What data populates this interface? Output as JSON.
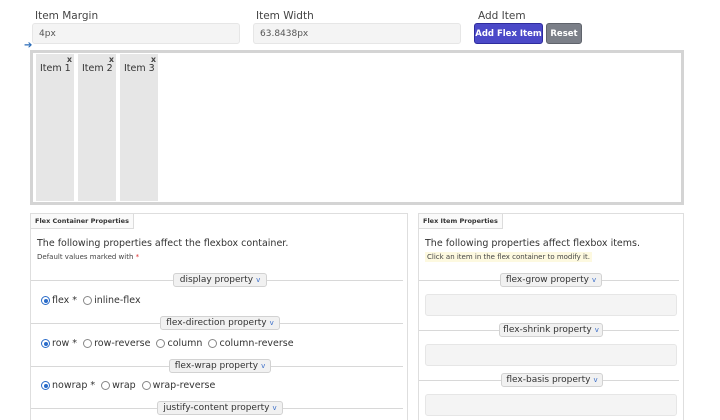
{
  "controls": {
    "item_margin_label": "Item Margin",
    "item_margin_value": "4px",
    "item_width_label": "Item Width",
    "item_width_value": "63.8438px",
    "add_item_label": "Add Item",
    "add_button": "Add Flex Item",
    "reset_button": "Reset"
  },
  "flex_items": [
    {
      "label": "Item 1",
      "remove": "x"
    },
    {
      "label": "Item 2",
      "remove": "x"
    },
    {
      "label": "Item 3",
      "remove": "x"
    }
  ],
  "container_panel": {
    "title": "Flex Container Properties",
    "description": "The following properties affect the flexbox container.",
    "note": "Default values marked with",
    "note_star": "*",
    "display": {
      "label": "display property",
      "options": [
        {
          "label": "flex *",
          "selected": true
        },
        {
          "label": "inline-flex",
          "selected": false
        }
      ]
    },
    "flex_direction": {
      "label": "flex-direction property",
      "options": [
        {
          "label": "row *",
          "selected": true
        },
        {
          "label": "row-reverse",
          "selected": false
        },
        {
          "label": "column",
          "selected": false
        },
        {
          "label": "column-reverse",
          "selected": false
        }
      ]
    },
    "flex_wrap": {
      "label": "flex-wrap property",
      "options": [
        {
          "label": "nowrap *",
          "selected": true
        },
        {
          "label": "wrap",
          "selected": false
        },
        {
          "label": "wrap-reverse",
          "selected": false
        }
      ]
    },
    "justify_content": {
      "label": "justify-content property"
    }
  },
  "item_panel": {
    "title": "Flex Item Properties",
    "description": "The following properties affect flexbox items.",
    "note": "Click an item in the flex container to modify it.",
    "flex_grow": {
      "label": "flex-grow property"
    },
    "flex_shrink": {
      "label": "flex-shrink property"
    },
    "flex_basis": {
      "label": "flex-basis property"
    }
  },
  "icons": {
    "chevron": "chevron-down-icon",
    "remove": "close-icon",
    "arrow": "arrow-right-icon"
  }
}
